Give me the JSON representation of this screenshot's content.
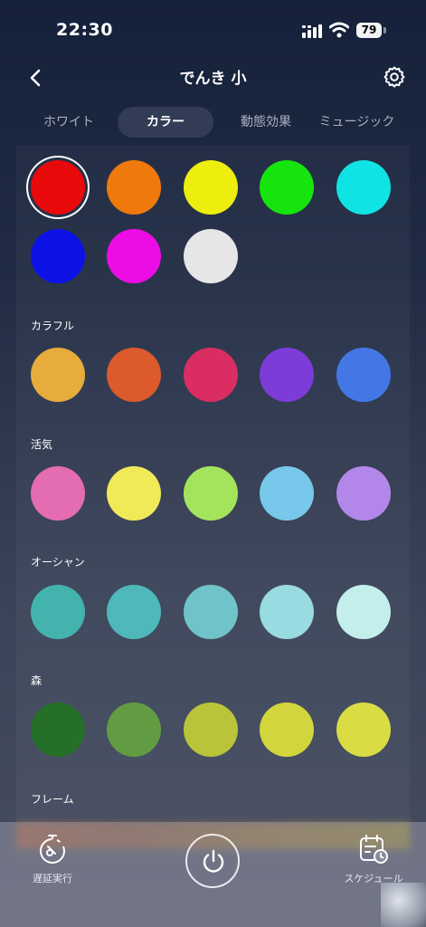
{
  "status_bar": {
    "time": "22:30",
    "battery": "79"
  },
  "nav": {
    "title": "でんき 小"
  },
  "tabs": [
    {
      "label": "ホワイト",
      "active": false
    },
    {
      "label": "カラー",
      "active": true
    },
    {
      "label": "動態効果",
      "active": false
    },
    {
      "label": "ミュージック",
      "active": false
    }
  ],
  "basic_colors": [
    "#e80a0a",
    "#f0790c",
    "#eded0e",
    "#16e50d",
    "#10e3e3",
    "#0c12e6",
    "#ec0ce6",
    "#e6e6e8"
  ],
  "selected_color": "#e80a0a",
  "sections": [
    {
      "label": "カラフル",
      "colors": [
        "#e6ac3c",
        "#dc5a2c",
        "#da2d64",
        "#7d3bd8",
        "#4477e6"
      ]
    },
    {
      "label": "活気",
      "colors": [
        "#e46cb1",
        "#f0ea58",
        "#a3e45c",
        "#77c8ea",
        "#b387ea"
      ]
    },
    {
      "label": "オーシャン",
      "colors": [
        "#43b3ae",
        "#4eb8bb",
        "#70c3c8",
        "#98dbe0",
        "#c4eeec"
      ]
    },
    {
      "label": "森",
      "colors": [
        "#266f28",
        "#629c42",
        "#b9c43a",
        "#d2d63c",
        "#dadc44"
      ]
    },
    {
      "label": "フレーム",
      "colors": []
    }
  ],
  "bottom": {
    "delay_label": "遅延実行",
    "schedule_label": "スケジュール"
  },
  "icons": [
    "back-icon",
    "gear-icon",
    "timer-icon",
    "power-icon",
    "calendar-clock-icon"
  ]
}
